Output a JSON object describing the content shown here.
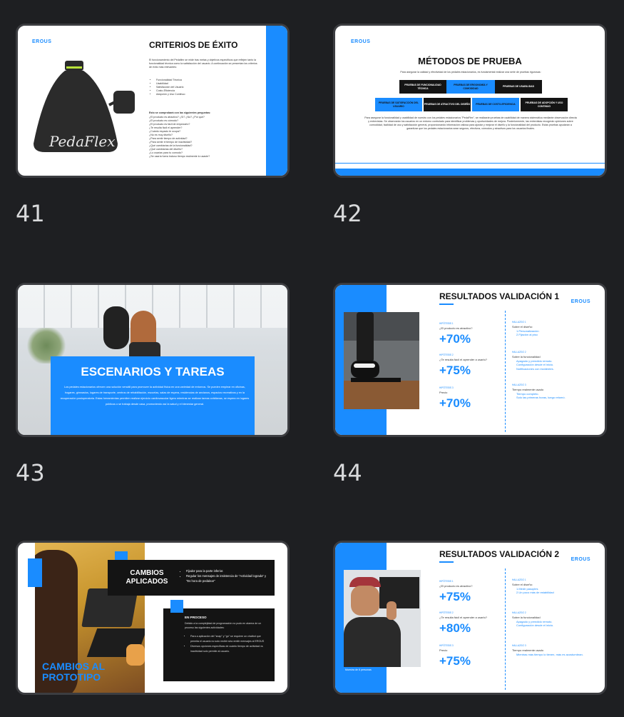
{
  "slides": [
    {
      "number": "41"
    },
    {
      "number": "42"
    },
    {
      "number": "43"
    },
    {
      "number": "44"
    },
    {
      "number": "45"
    },
    {
      "number": "46"
    }
  ],
  "logo": "EROUS",
  "s41": {
    "title": "CRITERIOS DE ÉXITO",
    "brand": "PedaFlex",
    "intro": "El funcionamiento del Pedaflex se mide tras metas y objetivos especificos que reflejen tanto la funcionalidad técnica como la satisfacción del usuario. A continuación se presentan los criterios de éxito más relevantes:",
    "bullets": [
      "Funcionalidad Técnica",
      "Usabilidad",
      "Satisfacción del Usuario",
      "Costo-Eficiencia",
      "Adopción y Uso Continuo"
    ],
    "sub": "Esto se comprobará con las siguientes preguntas:",
    "questions": [
      "¿El producto es atractivo? ¿Sí? ¿No? ¿Por qué?",
      "¿El producto es cómodo?",
      "¿El producto es fácil de empezarlo?",
      "¿Te resulta fácil el aprender?",
      "¿Cuánto espacio te ocupa?",
      "¿No es muy diseño?",
      "¿Para sentir tiempo de actividad?",
      "¿Para sentir el tiempo de inactividad?",
      "¿Qué cambiarías de la funcionalidad?",
      "¿Qué cambiarías del diseño?",
      "¿Lo usarías para tu comodo?",
      "¿Se usaría fuera incluso tiempo realmente lo usaste?"
    ]
  },
  "s42": {
    "title": "MÉTODOS DE PRUEBA",
    "intro": "Para asegurar la calidad y efectividad de los pedales estacionarios, es fundamental realizar una serie de pruebas rigurosas:",
    "row1": [
      "PRUEBAS DE FUNCIONALIDAD TÉCNICA",
      "PRUEBAS DE ERGONOMÍA Y COMODIDAD",
      "PRUEBAS DE USABILIDAD"
    ],
    "row2": [
      "PRUEBAS DE SATISFACCIÓN DEL USUARIO",
      "PRUEBAS DE ATRACTIVO DEL DISEÑO",
      "PRUEBAS DE COSTO-EFICIENCIA",
      "PRUEBAS DE ADOPCIÓN Y USO CONTINUO"
    ],
    "body": "Para asegurar la funcionalidad y usabilidad de nuestro con los pedales estacionarios \"PedaFlex\", se realizarán pruebas de usabilidad de manera sistemática mediante observación directa y entrevistas. Se observarán los usuarios en un entorno controlado para identificar problemas y oportunidades de mejora. Posteriormente, las entrevistas recogerán opiniones sobre comodidad, facilidad de uso y satisfacción general, proporcionando información valiosa para ajustar y mejorar el diseño y la funcionalidad del producto. Estas pruebas ayudarán a garantizar que los pedales estacionarios sean seguros, efectivos, cómodos y atractivos para los usuarios finales."
  },
  "s43": {
    "title": "ESCENARIOS Y TAREAS",
    "body": "Los pedales estacionarios ofrecen una solución versátil para promover la actividad física en una variedad de entornos. Se pueden emplear en oficinas, hogares, gimnasios, lugares de transporte, centros de rehabilitación, escuelas, salas de espera, residencias de ancianos, espacios recreativos y en la recuperación postoperatoria. Estas herramientas permiten realizar ejercicio cardiovascular ligero mientras se realizan tareas cotidianas, se espera en lugares públicos o se trabaja desde casa, promoviendo así la salud y el bienestar general."
  },
  "s44": {
    "title": "RESULTADOS VALIDACIÓN 1",
    "hyps": [
      {
        "label": "HIPÓTESIS 1",
        "q": "¿El producto es atractivo?",
        "v": "+70%"
      },
      {
        "label": "HIPÓTESIS 2",
        "q": "¿Te resulta fácil el aprender a usarlo?",
        "v": "+75%"
      },
      {
        "label": "HIPÓTESIS 3",
        "q": "Precio",
        "v": "+70%"
      }
    ],
    "finds": [
      {
        "label": "HALLAZGO 1",
        "head": "Sobre el diseño:",
        "items": [
          "1.Personalización",
          "2.Fijación al piso"
        ]
      },
      {
        "label": "HALLAZGO 2",
        "head": "Sobre la funcionalidad",
        "items": [
          "Apagado y prendido remoto.",
          "Configuración desde el inicio.",
          "Notificaciones con incidentes."
        ]
      },
      {
        "label": "HALLAZGO 3",
        "head": "Tiempo realmente usado",
        "items": [
          "Tiempo completo.",
          "Solo las primeras horas, luego retomó."
        ]
      }
    ]
  },
  "s45": {
    "title_top": "CAMBIOS APLICADOS",
    "bullets": [
      "Fijador para la parte inferior.",
      "Regular los mensajes de insistencia de \"Actividad lograda\" y \"Es hora de pedalear\""
    ],
    "proc_title": "EN PROCESO",
    "proc_body": "Debido a la complejidad de programación no pudo en alarma de un proceso las siguientes actividades:",
    "proc_bullets": [
      "Para a aplicación del \"snap\" y \"go\" se requiere un chatbot que permita el usuario no solo recibir sino emitir mensajes al EROUS",
      "Diversos opciones específicas de cuánto tiempo de actividad vs inactividad solo permite al usuario."
    ],
    "overlay": "CAMBIOS AL PROTOTIPO"
  },
  "s46": {
    "title": "RESULTADOS VALIDACIÓN 2",
    "caption": "Muestra de 6 personas",
    "hyps": [
      {
        "label": "HIPÓTESIS 1",
        "q": "¿El producto es atractivo?",
        "v": "+75%"
      },
      {
        "label": "HIPÓTESIS 2",
        "q": "¿Te resulta fácil el aprender a usarlo?",
        "v": "+80%"
      },
      {
        "label": "HIPÓTESIS 3",
        "q": "Precio",
        "v": "+75%"
      }
    ],
    "finds": [
      {
        "label": "HALLAZGO 1",
        "head": "Sobre el diseño:",
        "items": [
          "1.Medir pasoples",
          "2.Un poco más de estabilidad"
        ]
      },
      {
        "label": "HALLAZGO 2",
        "head": "Sobre la funcionalidad",
        "items": [
          "Apagado y prendido remoto.",
          "Configuración desde el inicio."
        ]
      },
      {
        "label": "HALLAZGO 3",
        "head": "Tiempo realmente usado",
        "items": [
          "Mientras más tiempo lo tienen, más es acostumbran."
        ]
      }
    ]
  },
  "colors": {
    "accent": "#1a8cff",
    "background": "#1e1f22",
    "dark": "#141414"
  }
}
